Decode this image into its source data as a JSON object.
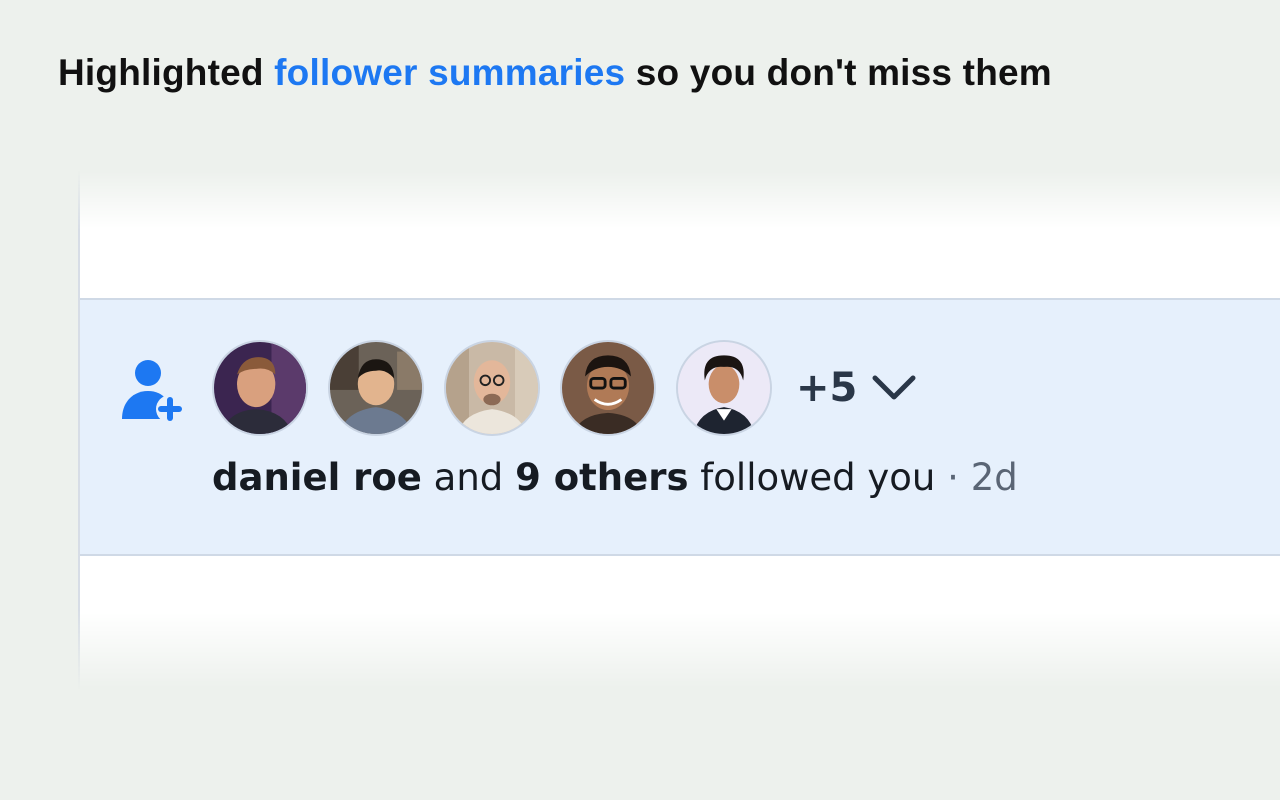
{
  "headline": {
    "prefix": "Highlighted",
    "accent": "follower summaries",
    "suffix": "so you don't miss them"
  },
  "notification": {
    "icon": "user-plus-icon",
    "avatars": [
      {
        "name": "avatar-1"
      },
      {
        "name": "avatar-2"
      },
      {
        "name": "avatar-3"
      },
      {
        "name": "avatar-4"
      },
      {
        "name": "avatar-5"
      }
    ],
    "more_count": "+5",
    "expand_icon": "chevron-down-icon",
    "actor": "daniel roe",
    "connector": "and",
    "others": "9 others",
    "action": "followed you",
    "separator": "·",
    "time": "2d"
  },
  "colors": {
    "accent": "#1d78f2",
    "highlight_bg": "#e6f0fc",
    "page_bg": "#edf1ed"
  }
}
